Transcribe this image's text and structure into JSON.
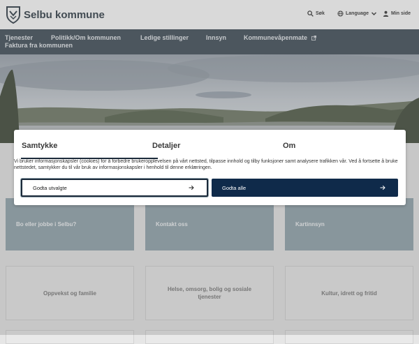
{
  "header": {
    "brand": "Selbu kommune",
    "search_label": "Søk",
    "language_label": "Language",
    "mypage_label": "Min side"
  },
  "nav": {
    "items": [
      "Tjenester",
      "Politikk/Om kommunen",
      "Ledige stillinger",
      "Innsyn",
      "Kommunevåpenmate",
      "Faktura fra kommunen"
    ]
  },
  "tiles": {
    "row1": [
      "Bo eller jobbe i Selbu?",
      "Kontakt oss",
      "Kartinnsyn"
    ],
    "row2": [
      "Oppvekst og familie",
      "Helse, omsorg, bolig og sosiale tjenester",
      "Kultur, idrett og fritid"
    ]
  },
  "consent": {
    "tabs": [
      "Samtykke",
      "Detaljer",
      "Om"
    ],
    "text": "Vi bruker informasjonskapsler (cookies) for å forbedre brukeropplevelsen på vårt nettsted, tilpasse innhold og tilby funksjoner samt analysere trafikken vår. Ved å fortsette å bruke nettstedet, samtykker du til vår bruk av informasjonskapsler i henhold til denne erklæringen.",
    "accept_selected": "Godta utvalgte",
    "accept_all": "Godta alle"
  },
  "colors": {
    "nav_bg": "#3c4a55",
    "primary_button": "#0f2a4a",
    "tile_dark": "#8fa2ab",
    "tab_underline": "#1b2a3a"
  }
}
